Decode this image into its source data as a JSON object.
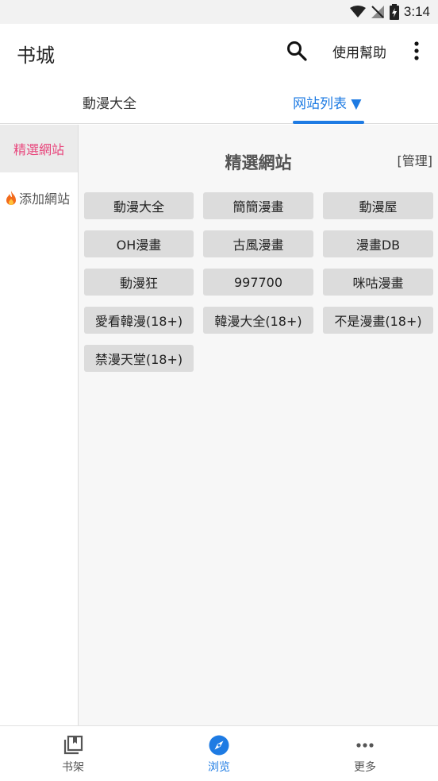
{
  "status": {
    "time": "3:14"
  },
  "header": {
    "title": "书城",
    "help_label": "使用幫助"
  },
  "tabs": [
    {
      "label": "動漫大全"
    },
    {
      "label": "网站列表 ▼"
    }
  ],
  "sidebar": {
    "items": [
      {
        "label": "精選網站"
      },
      {
        "label": "添加網站"
      }
    ]
  },
  "main": {
    "section_title": "精選網站",
    "manage_label": "[管理]",
    "sites": [
      "動漫大全",
      "簡簡漫畫",
      "動漫屋",
      "OH漫畫",
      "古風漫畫",
      "漫畫DB",
      "動漫狂",
      "997700",
      "咪咕漫畫",
      "愛看韓漫(18+)",
      "韓漫大全(18+)",
      "不是漫畫(18+)",
      "禁漫天堂(18+)"
    ]
  },
  "bottom_nav": [
    {
      "label": "书架",
      "icon": "bookshelf-icon"
    },
    {
      "label": "浏览",
      "icon": "compass-icon"
    },
    {
      "label": "更多",
      "icon": "more-horizontal-icon"
    }
  ],
  "colors": {
    "accent": "#1e7be3",
    "active_pink": "#e8467c",
    "button_bg": "#dcdcdc"
  }
}
